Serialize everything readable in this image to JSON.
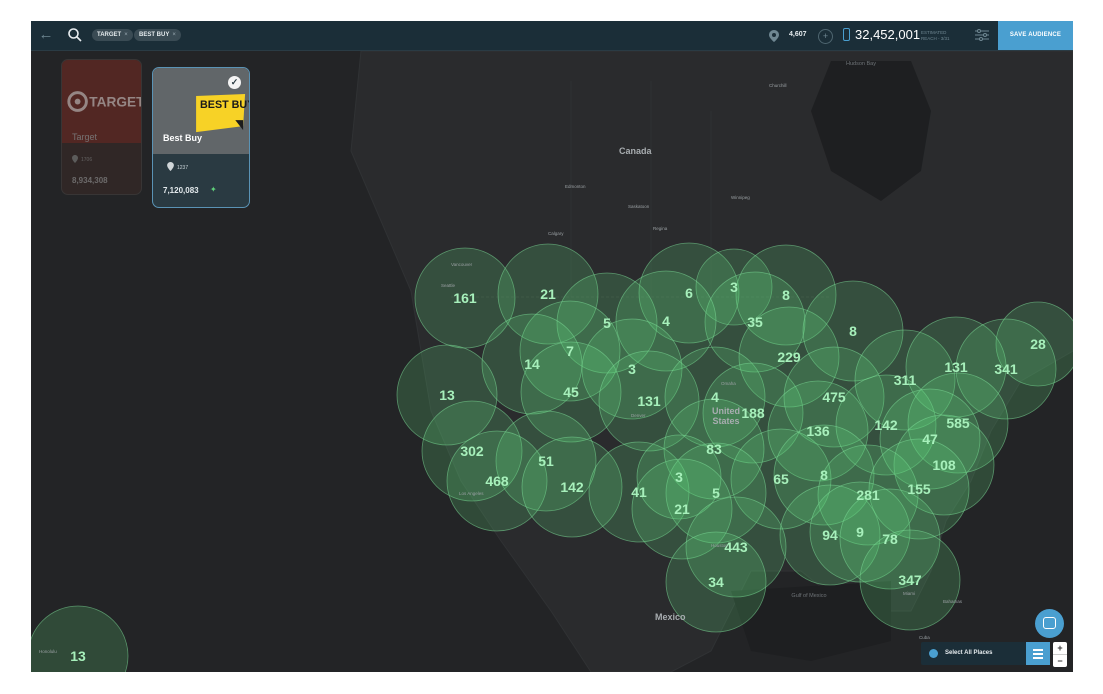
{
  "header": {
    "chips": [
      {
        "label": "TARGET"
      },
      {
        "label": "BEST BUY"
      }
    ],
    "places_count": "4,607",
    "reach_value": "32,452,001",
    "reach_label": "ESTIMATED REACH - 3/31",
    "save_label": "SAVE AUDIENCE"
  },
  "cards": [
    {
      "name": "Target",
      "places": "1706",
      "reach": "8,934,308",
      "logo_text": "TARGET"
    },
    {
      "name": "Best Buy",
      "places": "1237",
      "reach": "7,120,083",
      "logo_text": "BEST BUY"
    }
  ],
  "clusters": [
    {
      "count": "161"
    },
    {
      "count": "21"
    },
    {
      "count": "6"
    },
    {
      "count": "3"
    },
    {
      "count": "8"
    },
    {
      "count": "5"
    },
    {
      "count": "35"
    },
    {
      "count": "4"
    },
    {
      "count": "7"
    },
    {
      "count": "14"
    },
    {
      "count": "3"
    },
    {
      "count": "229"
    },
    {
      "count": "8"
    },
    {
      "count": "28"
    },
    {
      "count": "13"
    },
    {
      "count": "45"
    },
    {
      "count": "131"
    },
    {
      "count": "4"
    },
    {
      "count": "188"
    },
    {
      "count": "475"
    },
    {
      "count": "311"
    },
    {
      "count": "131"
    },
    {
      "count": "341"
    },
    {
      "count": "136"
    },
    {
      "count": "142"
    },
    {
      "count": "585"
    },
    {
      "count": "302"
    },
    {
      "count": "51"
    },
    {
      "count": "83"
    },
    {
      "count": "47"
    },
    {
      "count": "468"
    },
    {
      "count": "142"
    },
    {
      "count": "41"
    },
    {
      "count": "3"
    },
    {
      "count": "65"
    },
    {
      "count": "8"
    },
    {
      "count": "108"
    },
    {
      "count": "5"
    },
    {
      "count": "21"
    },
    {
      "count": "281"
    },
    {
      "count": "155"
    },
    {
      "count": "94"
    },
    {
      "count": "9"
    },
    {
      "count": "78"
    },
    {
      "count": "443"
    },
    {
      "count": "34"
    },
    {
      "count": "347"
    },
    {
      "count": "13"
    }
  ],
  "map_labels": {
    "canada": "Canada",
    "united_states": "United States",
    "mexico": "Mexico",
    "hudson_bay": "Hudson Bay",
    "gulf_of_mexico": "Gulf of Mexico",
    "bahamas": "Bahamas",
    "cuba": "Cuba",
    "vancouver": "Vancouver",
    "seattle": "Seattle",
    "calgary": "Calgary",
    "edmonton": "Edmonton",
    "saskatoon": "Saskatoon",
    "regina": "Regina",
    "winnipeg": "Winnipeg",
    "churchill": "Churchill",
    "los_angeles": "Los Angeles",
    "omaha": "Omaha",
    "denver": "Denver",
    "houston": "Houston",
    "miami": "Miami",
    "honolulu": "Honolulu"
  },
  "bottom_controls": {
    "select_all": "Select All Places",
    "zoom_in": "+",
    "zoom_out": "−"
  },
  "colors": {
    "accent": "#4a9fd0",
    "cluster_fill": "#5fd07a",
    "map_bg": "#232426"
  }
}
